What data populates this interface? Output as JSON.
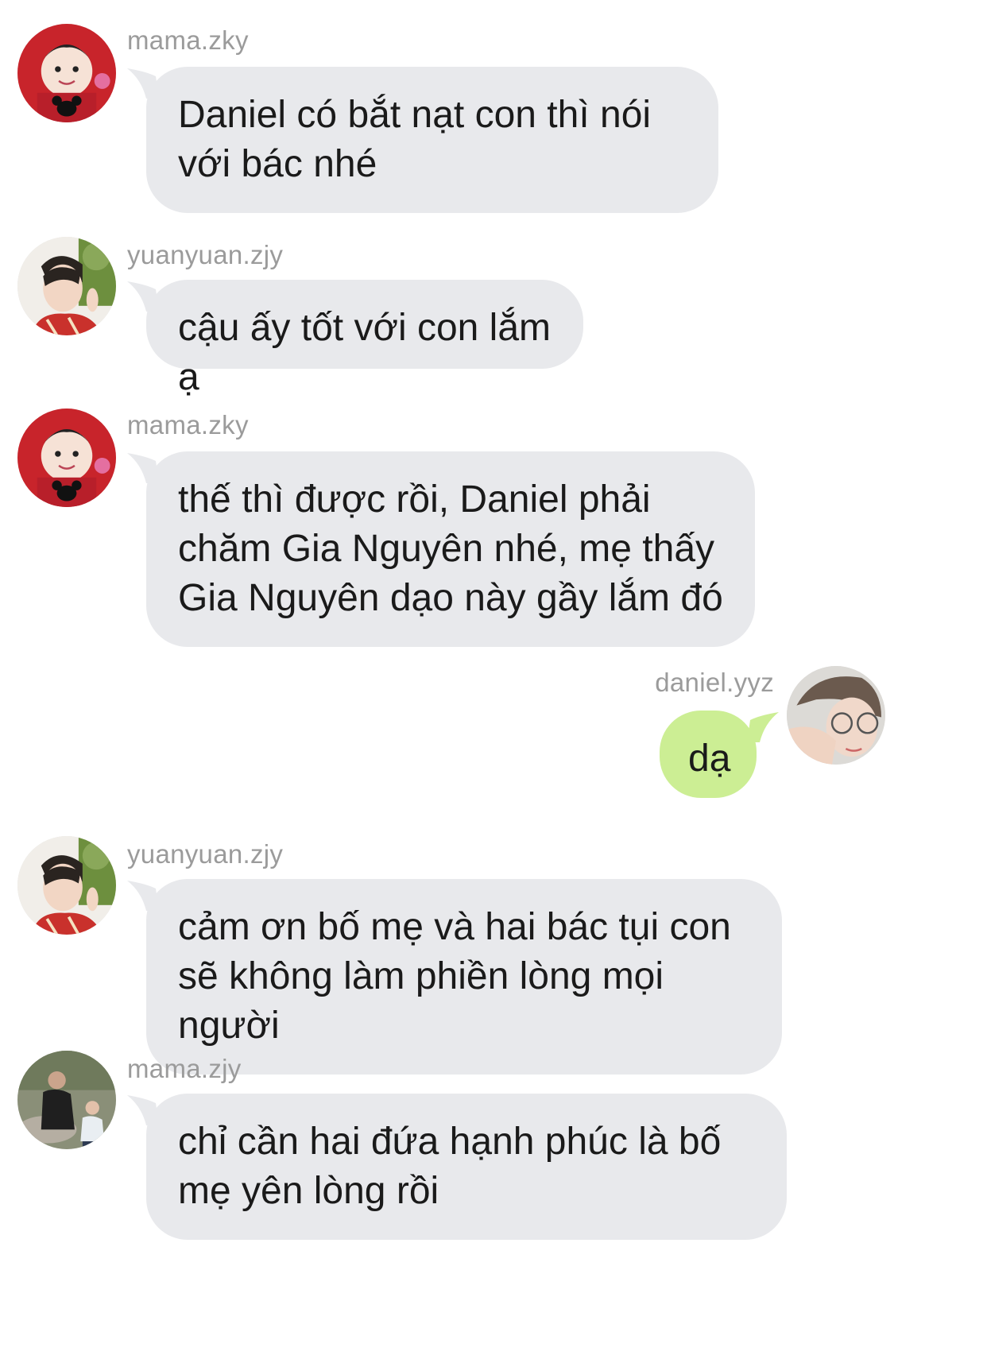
{
  "messages": [
    {
      "user": "mama.zky",
      "text": "Daniel có bắt nạt con thì nói với bác nhé",
      "side": "left",
      "avatar": "baby-avatar"
    },
    {
      "user": "yuanyuan.zjy",
      "text": "cậu ấy tốt với con lắm ạ",
      "side": "left",
      "avatar": "boy-avatar"
    },
    {
      "user": "mama.zky",
      "text": "thế thì được rồi, Daniel phải chăm Gia Nguyên nhé, mẹ thấy Gia Nguyên dạo này gầy lắm đó",
      "side": "left",
      "avatar": "baby-avatar"
    },
    {
      "user": "daniel.yyz",
      "text": "dạ",
      "side": "right",
      "avatar": "glasses-avatar"
    },
    {
      "user": "yuanyuan.zjy",
      "text": "cảm ơn bố mẹ và hai bác tụi con sẽ không làm phiền lòng mọi người",
      "side": "left",
      "avatar": "boy-avatar"
    },
    {
      "user": "mama.zjy",
      "text": "chỉ cần hai đứa hạnh phúc là bố mẹ yên lòng rồi",
      "side": "left",
      "avatar": "family-avatar"
    }
  ],
  "colors": {
    "incoming_bubble": "#e8e9ec",
    "outgoing_bubble": "#ccee94",
    "username": "#9b9b9b",
    "background": "#ffffff"
  }
}
